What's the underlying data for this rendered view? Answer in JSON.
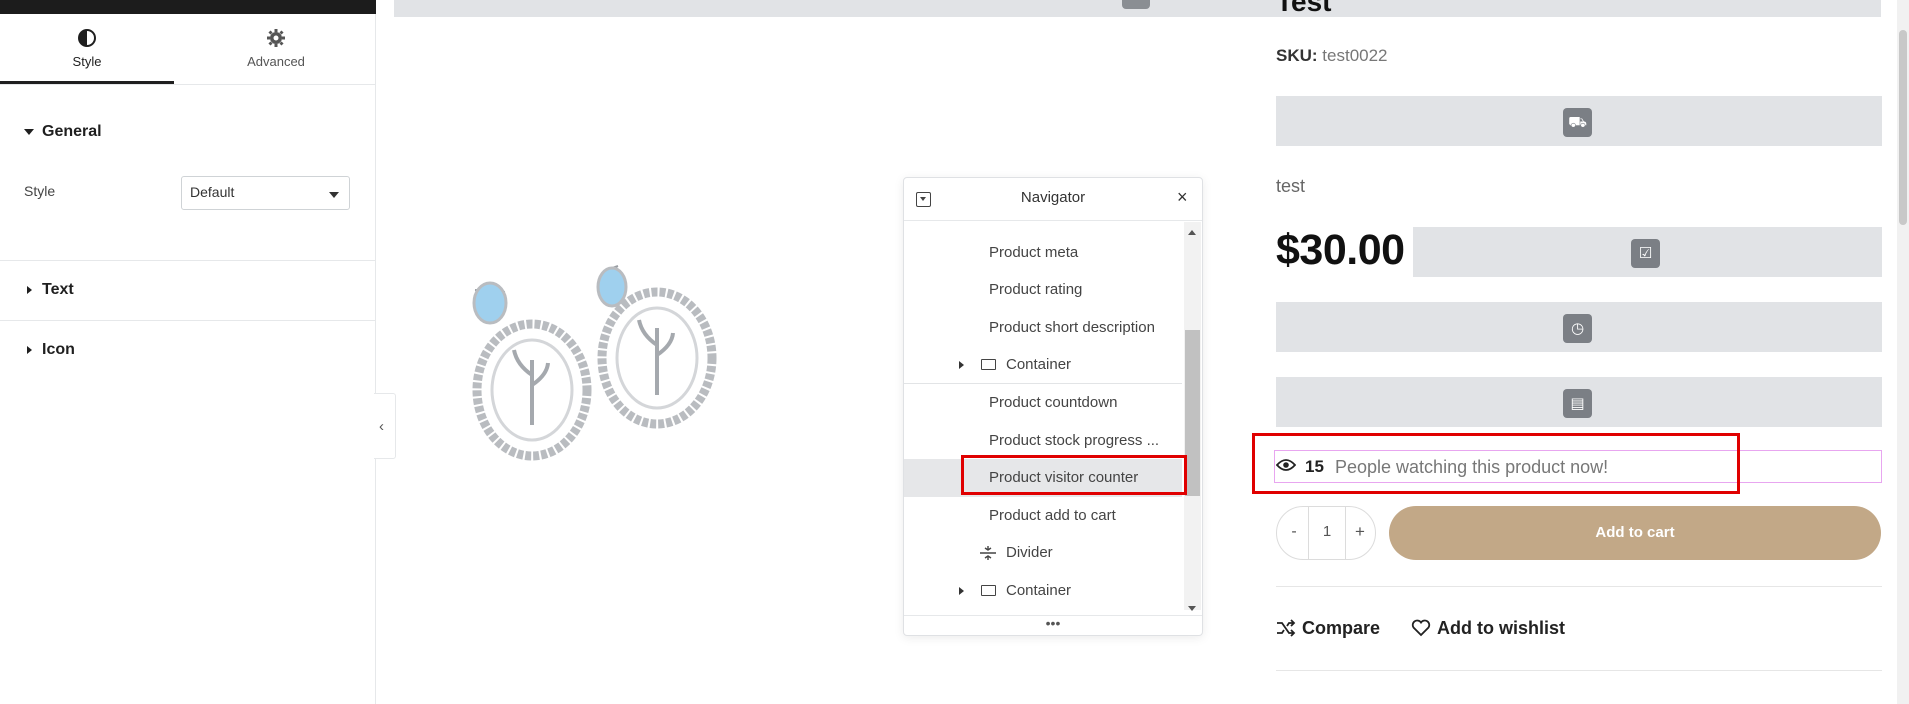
{
  "left_panel": {
    "tabs": [
      {
        "label": "Style",
        "icon": "contrast-icon",
        "active": true
      },
      {
        "label": "Advanced",
        "icon": "gear-icon",
        "active": false
      }
    ],
    "sections": {
      "general": {
        "label": "General",
        "expanded": true
      },
      "text": {
        "label": "Text",
        "expanded": false
      },
      "icon": {
        "label": "Icon",
        "expanded": false
      }
    },
    "style_control": {
      "label": "Style",
      "value": "Default"
    }
  },
  "product": {
    "title_partial": "Test",
    "sku_label": "SKU:",
    "sku_value": "test0022",
    "short_description": "test",
    "price": "$30.00",
    "visitor_counter": {
      "count": "15",
      "text": "People watching this product now!"
    },
    "quantity": "1",
    "qty_minus": "-",
    "qty_plus": "+",
    "add_to_cart_label": "Add to cart",
    "compare_label": "Compare",
    "wishlist_label": "Add to wishlist"
  },
  "navigator": {
    "title": "Navigator",
    "close": "×",
    "footer": "•••",
    "items": [
      {
        "label": "Product meta"
      },
      {
        "label": "Product rating"
      },
      {
        "label": "Product short description"
      },
      {
        "label": "Container",
        "icon": "container-icon",
        "expandable": true
      },
      {
        "label": "Product countdown"
      },
      {
        "label": "Product stock progress ..."
      },
      {
        "label": "Product visitor counter",
        "selected": true
      },
      {
        "label": "Product add to cart"
      },
      {
        "label": "Divider",
        "icon": "divider-icon"
      },
      {
        "label": "Container",
        "icon": "container-icon",
        "expandable": true
      }
    ]
  },
  "colors": {
    "accent_button": "#c2a887",
    "highlight_red": "#e00000",
    "selected_outline": "#e8a6f0",
    "placeholder_grey": "#e1e3e6"
  }
}
